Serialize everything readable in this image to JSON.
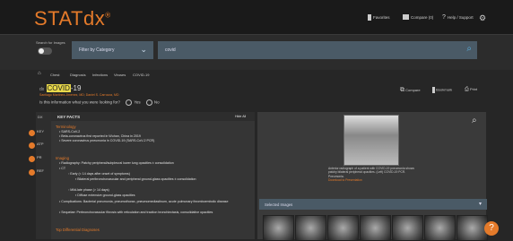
{
  "header": {
    "logo": "STATdx",
    "nav": {
      "favorites": "Favorites",
      "compare": "Compare (0)",
      "help": "Help / Support"
    }
  },
  "search": {
    "images_label": "Search for Images",
    "category": "Filter by Category",
    "query": "covid"
  },
  "breadcrumb": [
    "Chest",
    "Diagnosis",
    "Infections",
    "Viruses",
    "COVID-19"
  ],
  "document": {
    "title_highlight": "COVID",
    "title_rest": "-19",
    "authors": "Santiago Martinez-Jimenez, MD; Daniel S. Carrozza, MD",
    "question": "Is this information what you were looking for?",
    "yes": "Yes",
    "no": "No"
  },
  "actions": {
    "compare": "Compare",
    "bookmark": "Bookmark",
    "print": "Print"
  },
  "key_facts": {
    "heading": "KEY FACTS",
    "toggle": "Hide All",
    "sections": [
      {
        "title": "Terminology",
        "items": [
          "SARS-CoV-2",
          "Beta-coronavirus first reported in Wuhan, China in 2019",
          "Severe coronavirus pneumonia in COVID-19 (SARS-CoV-2 PCR)"
        ]
      },
      {
        "title": "Imaging",
        "items": [
          "Radiography: Patchy peripheral/subpleural lower lung opacities ± consolidation",
          "CT",
          "Early (< 14 days after onset of symptoms)",
          "Bilateral peribronchovascular and peripheral ground-glass opacities ± consolidation",
          "Mild-late phase (> 14 days)",
          "Diffuse extensive ground-glass opacities",
          "Complications: Bacterial pneumonia, pneumothorax, pneumomediastinum, acute pulmonary thromboembolic disease",
          "Sequelae: Perbronchovascular fibrosis with reticulation and traction bronchiectasis, consolidative opacities"
        ]
      },
      {
        "title": "Top Differential Diagnoses",
        "items": []
      }
    ]
  },
  "side_tabs": [
    "DX",
    "KEY",
    "ATP",
    "PR",
    "REF"
  ],
  "image_panel": {
    "caption": "Anterior radiograph of a patient with COVID-19 pneumonia shows patchy bilateral peripheral opacities. (Left) COVID-19 PCR. Pneumonia.",
    "caption_link": "Download to Presentation",
    "selected_header": "Selected Images"
  }
}
